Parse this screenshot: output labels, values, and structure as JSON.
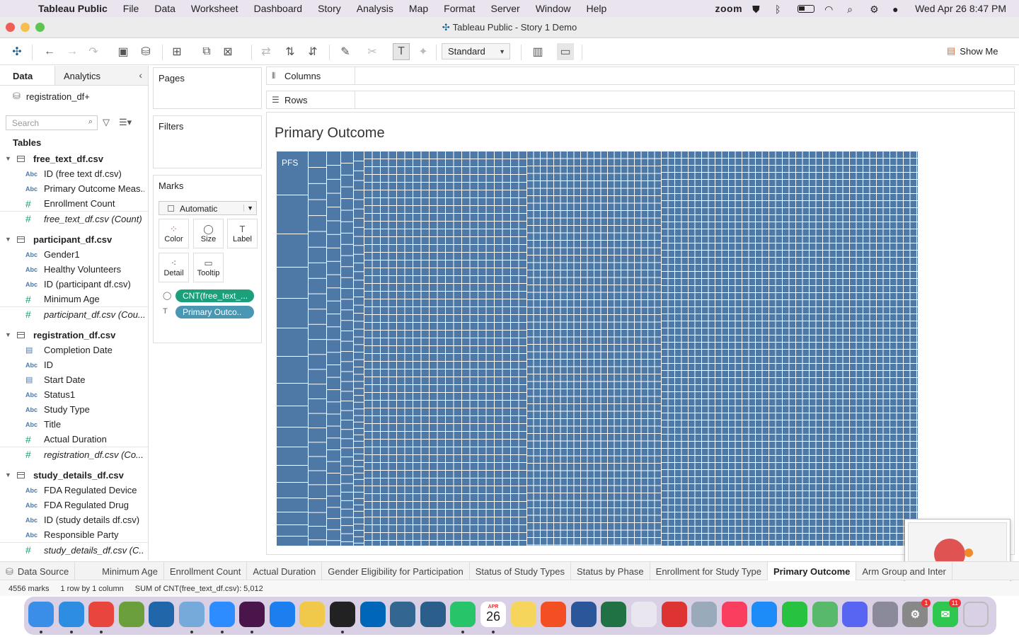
{
  "menubar": {
    "app_name": "Tableau Public",
    "items": [
      "File",
      "Data",
      "Worksheet",
      "Dashboard",
      "Story",
      "Analysis",
      "Map",
      "Format",
      "Server",
      "Window",
      "Help"
    ],
    "zoom_label": "zoom",
    "datetime": "Wed Apr 26  8:47 PM"
  },
  "window": {
    "title": "Tableau Public - Story 1 Demo"
  },
  "toolbar": {
    "fit_value": "Standard",
    "show_me_label": "Show Me"
  },
  "datapane": {
    "tab_data": "Data",
    "tab_analytics": "Analytics",
    "datasource": "registration_df+",
    "search_placeholder": "Search",
    "tables_label": "Tables",
    "groups": [
      {
        "name": "free_text_df.csv",
        "fields": [
          {
            "type": "Abc",
            "name": "ID (free text df.csv)"
          },
          {
            "type": "Abc",
            "name": "Primary Outcome Meas..."
          },
          {
            "type": "#",
            "name": "Enrollment Count"
          },
          {
            "type": "#",
            "name": "free_text_df.csv (Count)",
            "italic": true
          }
        ]
      },
      {
        "name": "participant_df.csv",
        "fields": [
          {
            "type": "Abc",
            "name": "Gender1"
          },
          {
            "type": "Abc",
            "name": "Healthy Volunteers"
          },
          {
            "type": "Abc",
            "name": "ID (participant df.csv)"
          },
          {
            "type": "#",
            "name": "Minimum Age"
          },
          {
            "type": "#",
            "name": "participant_df.csv (Cou...",
            "italic": true
          }
        ]
      },
      {
        "name": "registration_df.csv",
        "fields": [
          {
            "type": "date",
            "name": "Completion Date"
          },
          {
            "type": "Abc",
            "name": "ID"
          },
          {
            "type": "date",
            "name": "Start Date"
          },
          {
            "type": "Abc",
            "name": "Status1"
          },
          {
            "type": "Abc",
            "name": "Study Type"
          },
          {
            "type": "Abc",
            "name": "Title"
          },
          {
            "type": "#",
            "name": "Actual Duration"
          },
          {
            "type": "#",
            "name": "registration_df.csv (Co...",
            "italic": true
          }
        ]
      },
      {
        "name": "study_details_df.csv",
        "fields": [
          {
            "type": "Abc",
            "name": "FDA Regulated Device"
          },
          {
            "type": "Abc",
            "name": "FDA Regulated Drug"
          },
          {
            "type": "Abc",
            "name": "ID (study details df.csv)"
          },
          {
            "type": "Abc",
            "name": "Responsible Party"
          },
          {
            "type": "#",
            "name": "study_details_df.csv (C...",
            "italic": true
          }
        ]
      }
    ]
  },
  "cards": {
    "pages": "Pages",
    "filters": "Filters",
    "marks": "Marks",
    "mark_type": "Automatic",
    "buttons": {
      "color": "Color",
      "size": "Size",
      "label": "Label",
      "detail": "Detail",
      "tooltip": "Tooltip"
    },
    "pill_size": "CNT(free_text_...",
    "pill_label": "Primary Outco.."
  },
  "shelves": {
    "columns": "Columns",
    "rows": "Rows"
  },
  "view": {
    "title": "Primary Outcome",
    "first_label": "PFS",
    "mark_color": "#4e79a7"
  },
  "chart_data": {
    "type": "treemap",
    "title": "Primary Outcome",
    "labels": [
      "PFS"
    ],
    "mark_count": 4556,
    "total": 5012
  },
  "sheet_tabs": [
    "Data Source",
    "Minimum Age",
    "Enrollment Count",
    "Actual Duration",
    "Gender Eligibility for Participation",
    "Status of Study Types",
    "Status by Phase",
    "Enrollment for Study Type",
    "Primary Outcome",
    "Arm Group and Inter"
  ],
  "active_tab": "Primary Outcome",
  "status": {
    "marks": "4556 marks",
    "dims": "1 row by 1 column",
    "sum": "SUM of CNT(free_text_df.csv): 5,012"
  },
  "dock": {
    "calendar_month": "APR",
    "calendar_day": "26",
    "badge_system": "1",
    "badge_messages": "11",
    "apps": [
      "finder-icon",
      "safari-icon",
      "chrome-icon",
      "minecraft-icon",
      "r-icon",
      "rstudio-icon",
      "zoom-icon",
      "slack-icon",
      "xcode-icon",
      "python-icon",
      "terminal-icon",
      "vscode-icon",
      "postgres-icon",
      "tableau-icon",
      "activity-icon",
      "calendar-icon",
      "notes-icon",
      "microsoft-icon",
      "word-icon",
      "excel-icon",
      "photos-icon",
      "photobooth-icon",
      "preview-icon",
      "music-icon",
      "appstore-icon",
      "facetime-icon",
      "maps-icon",
      "discord-icon",
      "launchpad-icon",
      "settings-icon",
      "messages-icon",
      "trash-icon"
    ]
  }
}
